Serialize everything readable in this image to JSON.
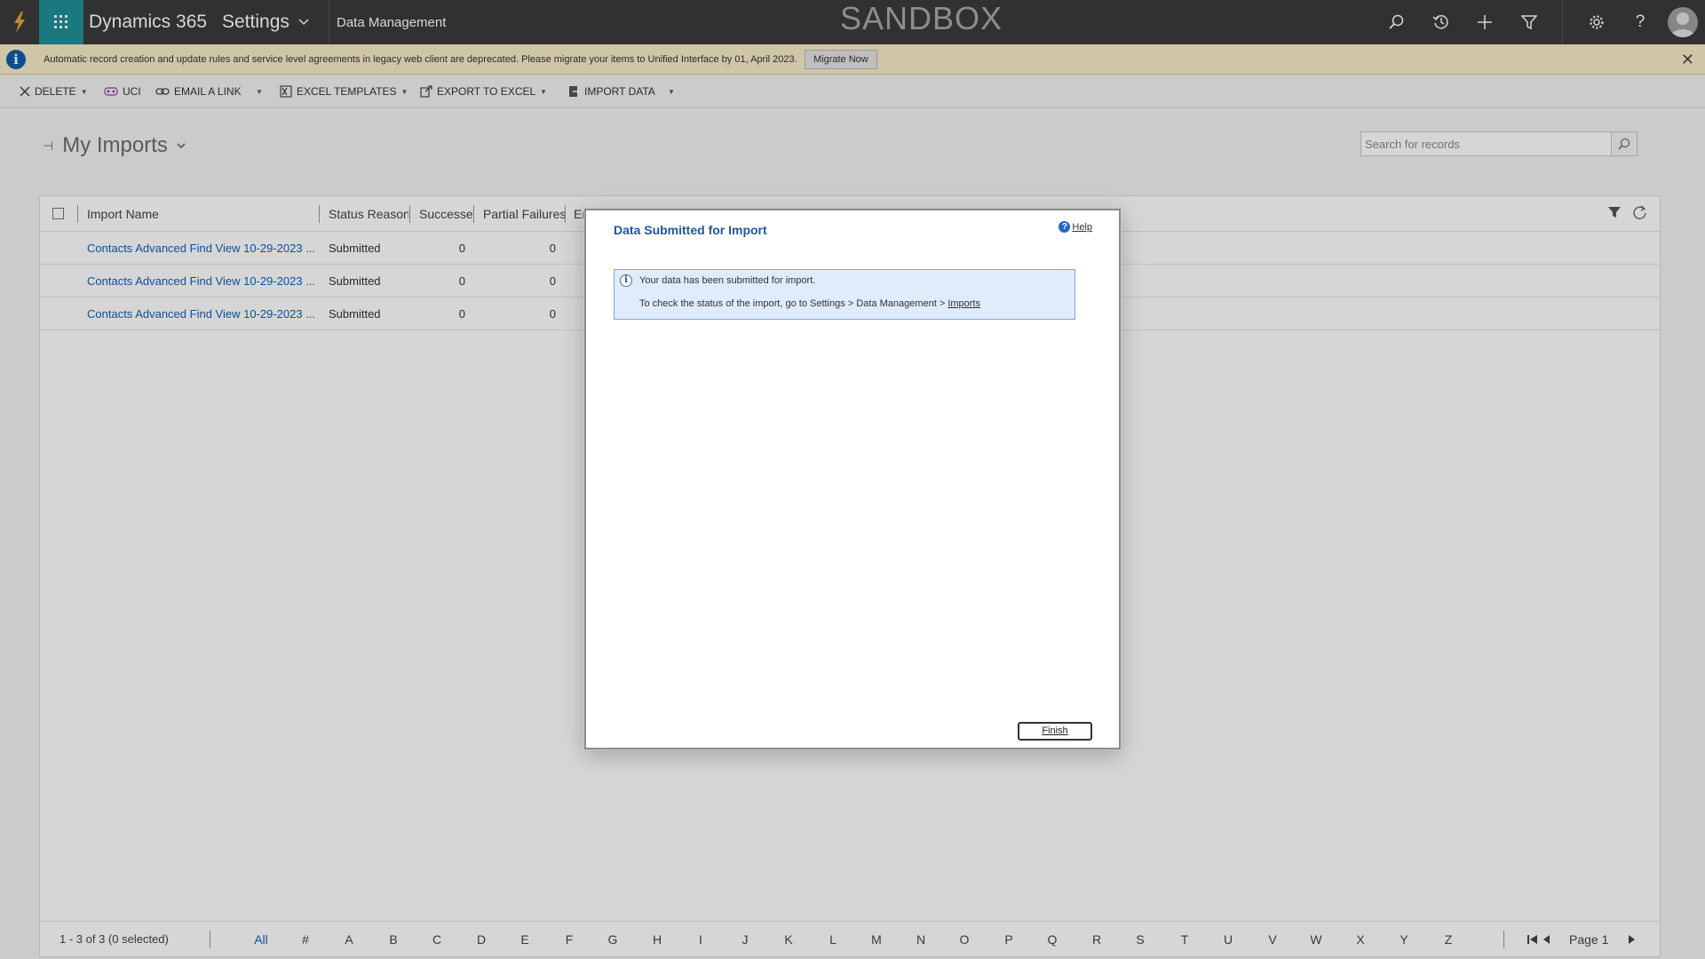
{
  "topbar": {
    "app_name": "Dynamics 365",
    "area": "Settings",
    "breadcrumb": "Data Management",
    "environment": "SANDBOX"
  },
  "notice": {
    "text": "Automatic record creation and update rules and service level agreements in legacy web client are deprecated. Please migrate your items to Unified Interface by 01, April 2023.",
    "button": "Migrate Now"
  },
  "commands": {
    "delete": "DELETE",
    "uci": "UCI",
    "email_link": "EMAIL A LINK",
    "excel_templates": "EXCEL TEMPLATES",
    "export_excel": "EXPORT TO EXCEL",
    "import_data": "IMPORT DATA"
  },
  "view": {
    "title": "My Imports",
    "search_placeholder": "Search for records"
  },
  "grid": {
    "columns": [
      "Import Name",
      "Status Reason",
      "Successes",
      "Partial Failures",
      "Er"
    ],
    "rows": [
      {
        "name": "Contacts Advanced Find View 10-29-2023 ...",
        "status": "Submitted",
        "successes": "0",
        "partial": "0"
      },
      {
        "name": "Contacts Advanced Find View 10-29-2023 ...",
        "status": "Submitted",
        "successes": "0",
        "partial": "0"
      },
      {
        "name": "Contacts Advanced Find View 10-29-2023 ...",
        "status": "Submitted",
        "successes": "0",
        "partial": "0"
      }
    ]
  },
  "footer": {
    "count": "1 - 3 of 3 (0 selected)",
    "letters": [
      "All",
      "#",
      "A",
      "B",
      "C",
      "D",
      "E",
      "F",
      "G",
      "H",
      "I",
      "J",
      "K",
      "L",
      "M",
      "N",
      "O",
      "P",
      "Q",
      "R",
      "S",
      "T",
      "U",
      "V",
      "W",
      "X",
      "Y",
      "Z"
    ],
    "page": "Page 1"
  },
  "dialog": {
    "title": "Data Submitted for Import",
    "help": "Help",
    "line1": "Your data has been submitted for import.",
    "line2_prefix": "To check the status of the import, go to Settings > Data Management > ",
    "line2_link": "Imports",
    "finish": "Finish"
  },
  "colors": {
    "topbar": "#3b3b3b",
    "app_tile": "#1f8f98",
    "link": "#1160b7",
    "dialog_title": "#1f57a4",
    "notice_bg": "#f6ecc8",
    "info_bg": "#deecfc"
  }
}
